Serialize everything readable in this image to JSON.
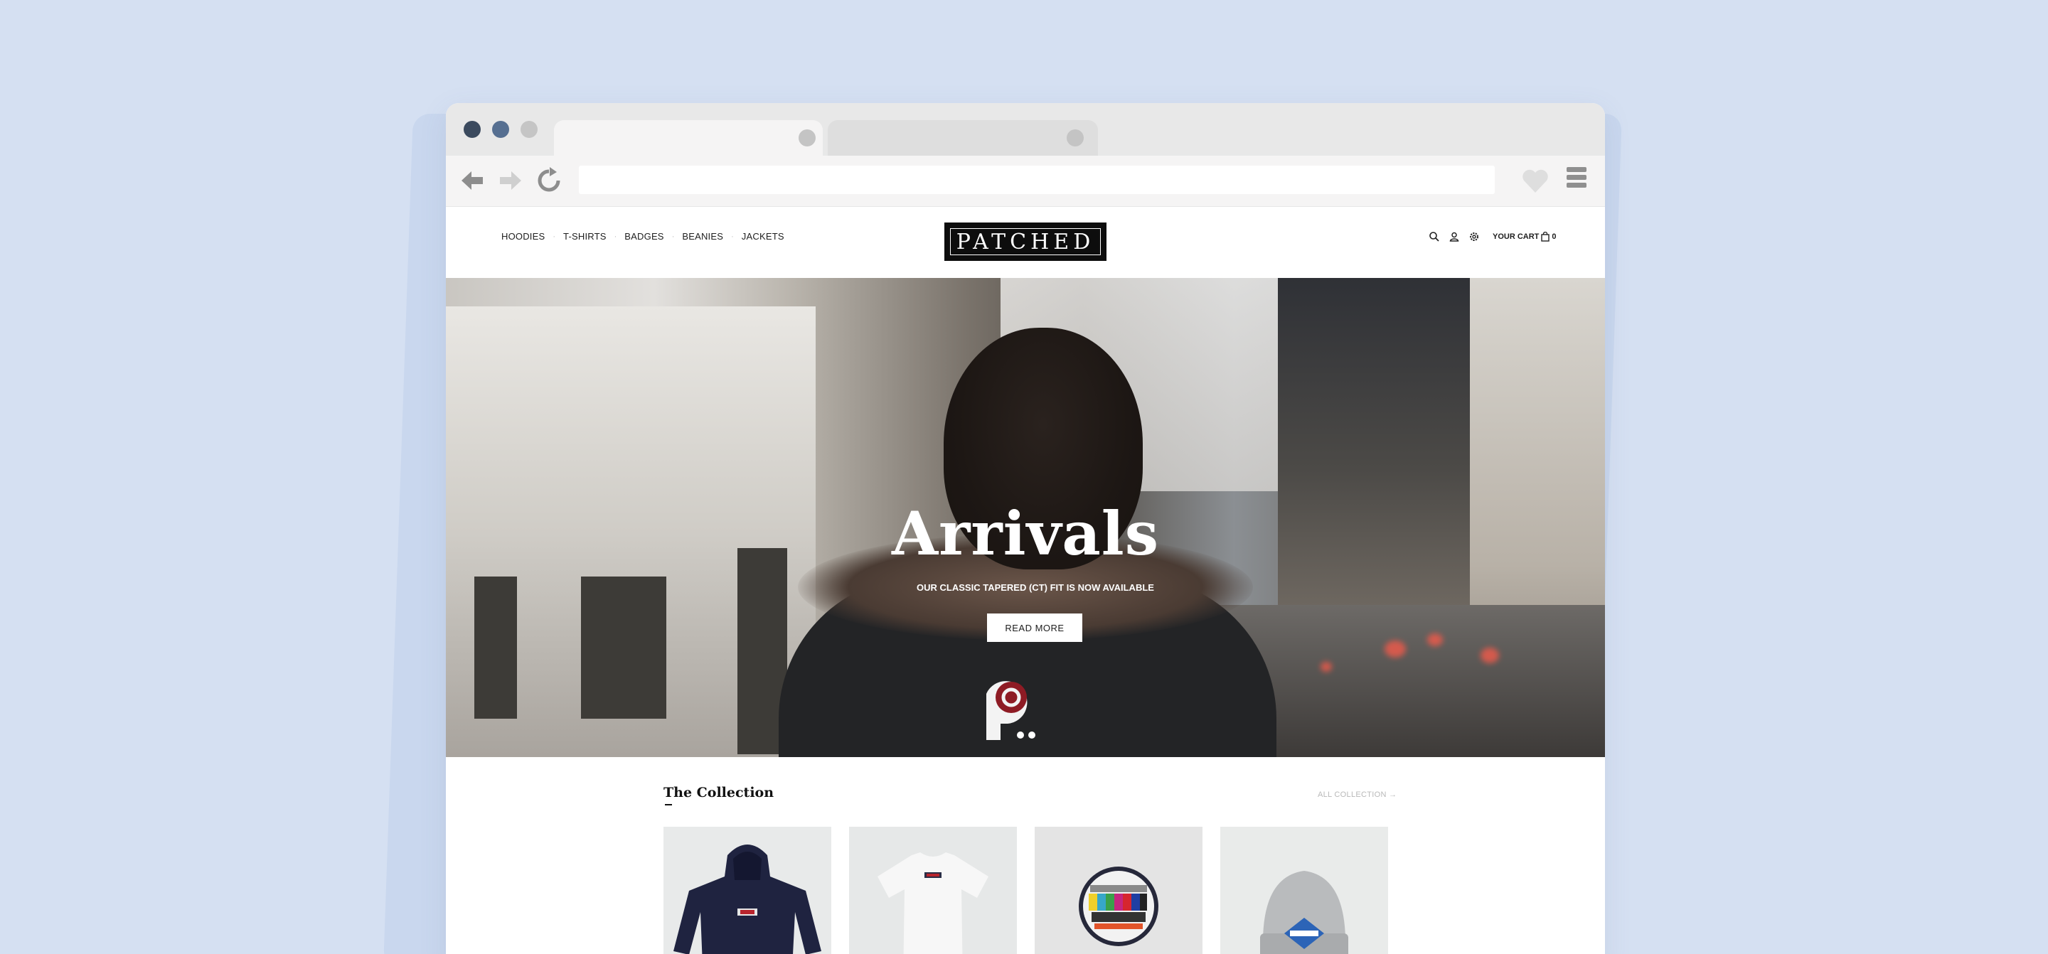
{
  "browser": {
    "window_controls": [
      "close",
      "minimize",
      "maximize"
    ],
    "tabs": [
      {
        "active": true
      },
      {
        "active": false
      }
    ],
    "address_bar": {
      "value": ""
    },
    "nav_icons": [
      "back-arrow-icon",
      "forward-arrow-icon",
      "reload-icon",
      "heart-icon",
      "hamburger-menu-icon"
    ]
  },
  "site": {
    "nav": {
      "items": [
        "HOODIES",
        "T-SHIRTS",
        "BADGES",
        "BEANIES",
        "JACKETS"
      ],
      "separator": "·"
    },
    "logo": "PATCHED",
    "header": {
      "icons": [
        "search-icon",
        "user-icon",
        "settings-icon"
      ],
      "cart_label": "YOUR CART",
      "cart_count": "0"
    },
    "hero": {
      "title": "Arrivals",
      "subtitle": "OUR CLASSIC TAPERED (CT) FIT IS NOW AVAILABLE",
      "button": "READ MORE",
      "slides": 2,
      "active_slide": 1
    },
    "collection": {
      "title": "The Collection",
      "link": "ALL COLLECTION →",
      "products": [
        {
          "name": "hoodie"
        },
        {
          "name": "t-shirt"
        },
        {
          "name": "badge"
        },
        {
          "name": "beanie"
        }
      ]
    }
  },
  "colors": {
    "page_bg": "#d5e0f2",
    "logo_bg": "#0d0d0d",
    "titlebar_bg": "#e8e8e8",
    "toolbar_bg": "#f5f4f4"
  }
}
